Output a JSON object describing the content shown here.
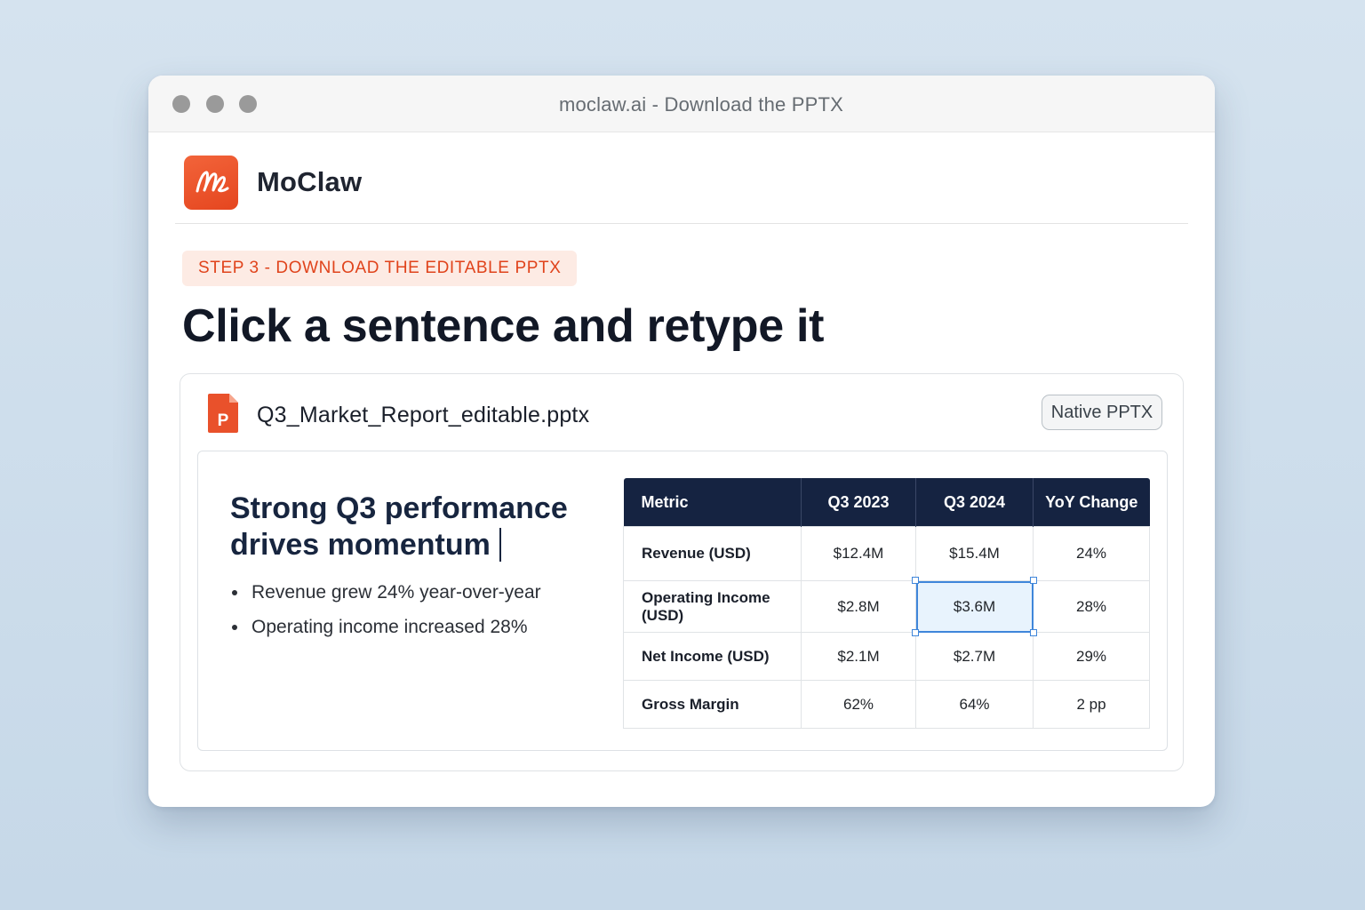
{
  "window": {
    "title": "moclaw.ai - Download the PPTX"
  },
  "brand": {
    "name": "MoClaw",
    "logo_icon": "signature-logo-icon",
    "accent_color": "#e9512b"
  },
  "step": {
    "label": "STEP 3 - DOWNLOAD THE EDITABLE PPTX"
  },
  "headline": "Click a sentence and retype it",
  "file": {
    "name": "Q3_Market_Report_editable.pptx",
    "icon": "powerpoint-file-icon",
    "icon_letter": "P",
    "badge": "Native PPTX"
  },
  "slide": {
    "title": "Strong Q3 performance drives momentum",
    "bullets": [
      "Revenue grew 24% year-over-year",
      "Operating income increased 28%"
    ],
    "table": {
      "headers": [
        "Metric",
        "Q3 2023",
        "Q3 2024",
        "YoY Change"
      ],
      "rows": [
        [
          "Revenue (USD)",
          "$12.4M",
          "$15.4M",
          "24%"
        ],
        [
          "Operating Income (USD)",
          "$2.8M",
          "$3.6M",
          "28%"
        ],
        [
          "Net Income (USD)",
          "$2.1M",
          "$2.7M",
          "29%"
        ],
        [
          "Gross Margin",
          "62%",
          "64%",
          "2 pp"
        ]
      ],
      "selected_cell": "Operating Income (USD) / Q3 2024",
      "header_color": "#152341",
      "selection_color": "#3f86da"
    }
  }
}
